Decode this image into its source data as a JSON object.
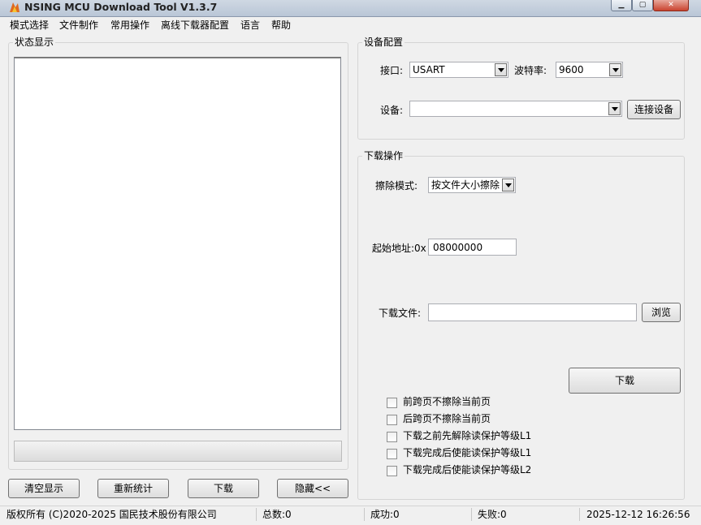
{
  "window": {
    "title": "NSING MCU Download Tool V1.3.7"
  },
  "menu": [
    "模式选择",
    "文件制作",
    "常用操作",
    "离线下载器配置",
    "语言",
    "帮助"
  ],
  "status_panel": {
    "title": "状态显示",
    "progress": 0
  },
  "bottom_buttons": {
    "clear": "清空显示",
    "recount": "重新统计",
    "download": "下载",
    "hide": "隐藏<<"
  },
  "device_config": {
    "title": "设备配置",
    "port_label": "接口:",
    "port_value": "USART",
    "baud_label": "波特率:",
    "baud_value": "9600",
    "device_label": "设备:",
    "device_value": "",
    "connect_button": "连接设备"
  },
  "download_ops": {
    "title": "下载操作",
    "erase_label": "擦除模式:",
    "erase_value": "按文件大小擦除",
    "address_label": "起始地址:0x",
    "address_value": "08000000",
    "file_label": "下载文件:",
    "file_value": "",
    "browse_button": "浏览",
    "download_button": "下载",
    "options": [
      {
        "label": "前跨页不擦除当前页",
        "checked": false
      },
      {
        "label": "后跨页不擦除当前页",
        "checked": false
      },
      {
        "label": "下载之前先解除读保护等级L1",
        "checked": false
      },
      {
        "label": "下载完成后使能读保护等级L1",
        "checked": false
      },
      {
        "label": "下载完成后使能读保护等级L2",
        "checked": false
      }
    ]
  },
  "statusbar": {
    "copyright": "版权所有 (C)2020-2025 国民技术股份有限公司",
    "total": "总数:0",
    "success": "成功:0",
    "fail": "失败:0",
    "datetime": "2025-12-12 16:26:56"
  },
  "colors": {
    "progress_fill": "#06b025",
    "title_bar": "#c3cfdd"
  }
}
